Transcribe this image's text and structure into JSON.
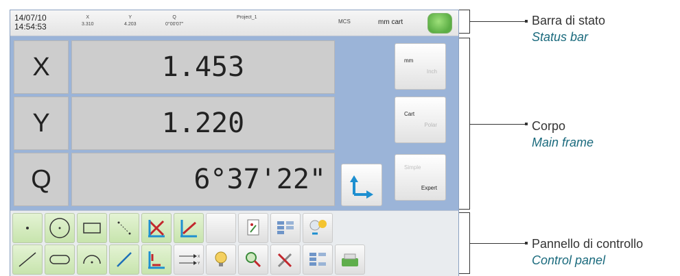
{
  "status_bar": {
    "date": "14/07/10",
    "time": "14:54:53",
    "x_label": "X",
    "x_value": "3.310",
    "y_label": "Y",
    "y_value": "4.203",
    "q_label": "Q",
    "q_value": "0°00'07\"",
    "project": "Project_1",
    "coord_system": "MCS",
    "units": "mm cart"
  },
  "readouts": [
    {
      "axis": "X",
      "value": "1.453"
    },
    {
      "axis": "Y",
      "value": "1.220"
    },
    {
      "axis": "Q",
      "value": "6°37'22\""
    }
  ],
  "side_buttons": {
    "units": {
      "active": "mm",
      "inactive": "Inch"
    },
    "coords": {
      "active": "Cart",
      "inactive": "Polar"
    },
    "mode": {
      "inactive": "Simple",
      "active": "Expert"
    }
  },
  "callouts": {
    "status": {
      "it": "Barra di stato",
      "en": "Status bar"
    },
    "main": {
      "it": "Corpo",
      "en": "Main frame"
    },
    "panel": {
      "it": "Pannello di controllo",
      "en": "Control panel"
    }
  },
  "colors": {
    "main_background": "#9bb4d8",
    "readout_field": "#cdcdcd",
    "tool_green": "#c7e4ad",
    "status_led": "#5cae45",
    "callout_italic": "#1a6a7d"
  }
}
